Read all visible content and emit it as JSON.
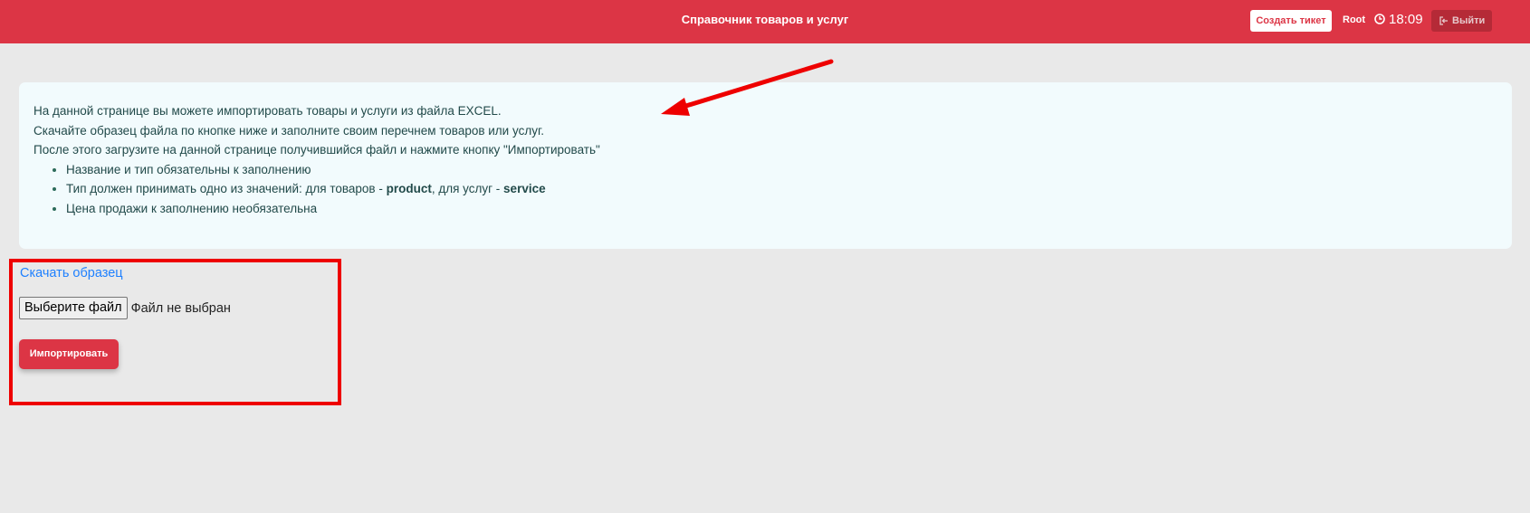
{
  "header": {
    "title": "Справочник товаров и услуг",
    "create_ticket_label": "Создать тикет",
    "user_name": "Root",
    "time": "18:09",
    "logout_label": "Выйти",
    "accent_color": "#dc3545"
  },
  "info": {
    "line1": "На данной странице вы можете импортировать товары и услуги из файла EXCEL.",
    "line2": "Скачайте образец файла по кнопке ниже и заполните своим перечнем товаров или услуг.",
    "line3": "После этого загрузите на данной странице получившийся файл и нажмите кнопку \"Импортировать\"",
    "bullet1": "Название и тип обязательны к заполнению",
    "bullet2_prefix": "Тип должен принимать одно из значений: для товаров - ",
    "bullet2_product": "product",
    "bullet2_middle": ", для услуг - ",
    "bullet2_service": "service",
    "bullet3": "Цена продажи к заполнению необязательна"
  },
  "form": {
    "download_link": "Скачать образец",
    "file_button_label": "Выберите файл",
    "file_status": "Файл не выбран",
    "import_button_label": "Импортировать"
  },
  "annotations": {
    "color": "#ee0000"
  }
}
